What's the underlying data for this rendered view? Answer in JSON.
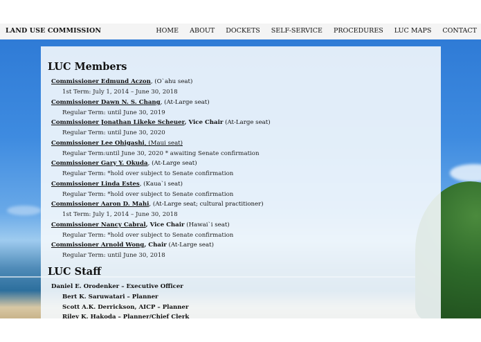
{
  "header": {
    "brand": "LAND USE COMMISSION",
    "nav": [
      "HOME",
      "ABOUT",
      "DOCKETS",
      "SELF-SERVICE",
      "PROCEDURES",
      "LUC MAPS",
      "CONTACT"
    ]
  },
  "members_heading": "LUC Members",
  "members": [
    {
      "name": "Commissioner Edmund Aczon",
      "role": "",
      "seat": ", (O`ahu seat)",
      "term": "1st Term: July 1, 2014 – June 30, 2018"
    },
    {
      "name": "Commissioner Dawn N. S. Chang",
      "role": "",
      "seat": ", (At-Large seat)",
      "term": "Regular Term: until June 30, 2019"
    },
    {
      "name": "Commissioner Jonathan Likeke Scheuer",
      "role": ", Vice Chair",
      "seat": " (At-Large seat)",
      "term": "Regular Term: until June 30, 2020"
    },
    {
      "name": "Commissioner Lee Ohigashi",
      "role": "",
      "seat": ", (Maui seat)",
      "term": "Regular Term:until June 30, 2020 * awaiting Senate confirmation"
    },
    {
      "name": "Commissioner Gary Y. Okuda",
      "role": "",
      "seat": ", (At-Large seat)",
      "term": "Regular Term: *hold over subject to Senate confirmation"
    },
    {
      "name": "Commissioner Linda Estes",
      "role": "",
      "seat": ", (Kaua`i seat)",
      "term": "Regular Term: *hold over subject to Senate confirmation"
    },
    {
      "name": "Commissioner Aaron D. Mahi",
      "role": "",
      "seat": ", (At-Large seat; cultural practitioner)",
      "term": "1st Term: July 1, 2014 – June 30, 2018"
    },
    {
      "name": "Commissioner Nancy Cabral",
      "role": ", Vice Chair",
      "seat": " (Hawai`i seat)",
      "term": "Regular Term: *hold over subject to Senate confirmation"
    },
    {
      "name": "Commissioner Arnold Wong",
      "role": ", Chair",
      "seat": " (At-Large seat)",
      "term": "Regular Term: until June 30, 2018"
    }
  ],
  "staff_heading": "LUC Staff",
  "staff": [
    "Daniel E. Orodenker – Executive Officer",
    "Bert K. Saruwatari – Planner",
    "Scott A.K. Derrickson, AICP – Planner",
    "Riley K. Hakoda – Planner/Chief Clerk"
  ]
}
